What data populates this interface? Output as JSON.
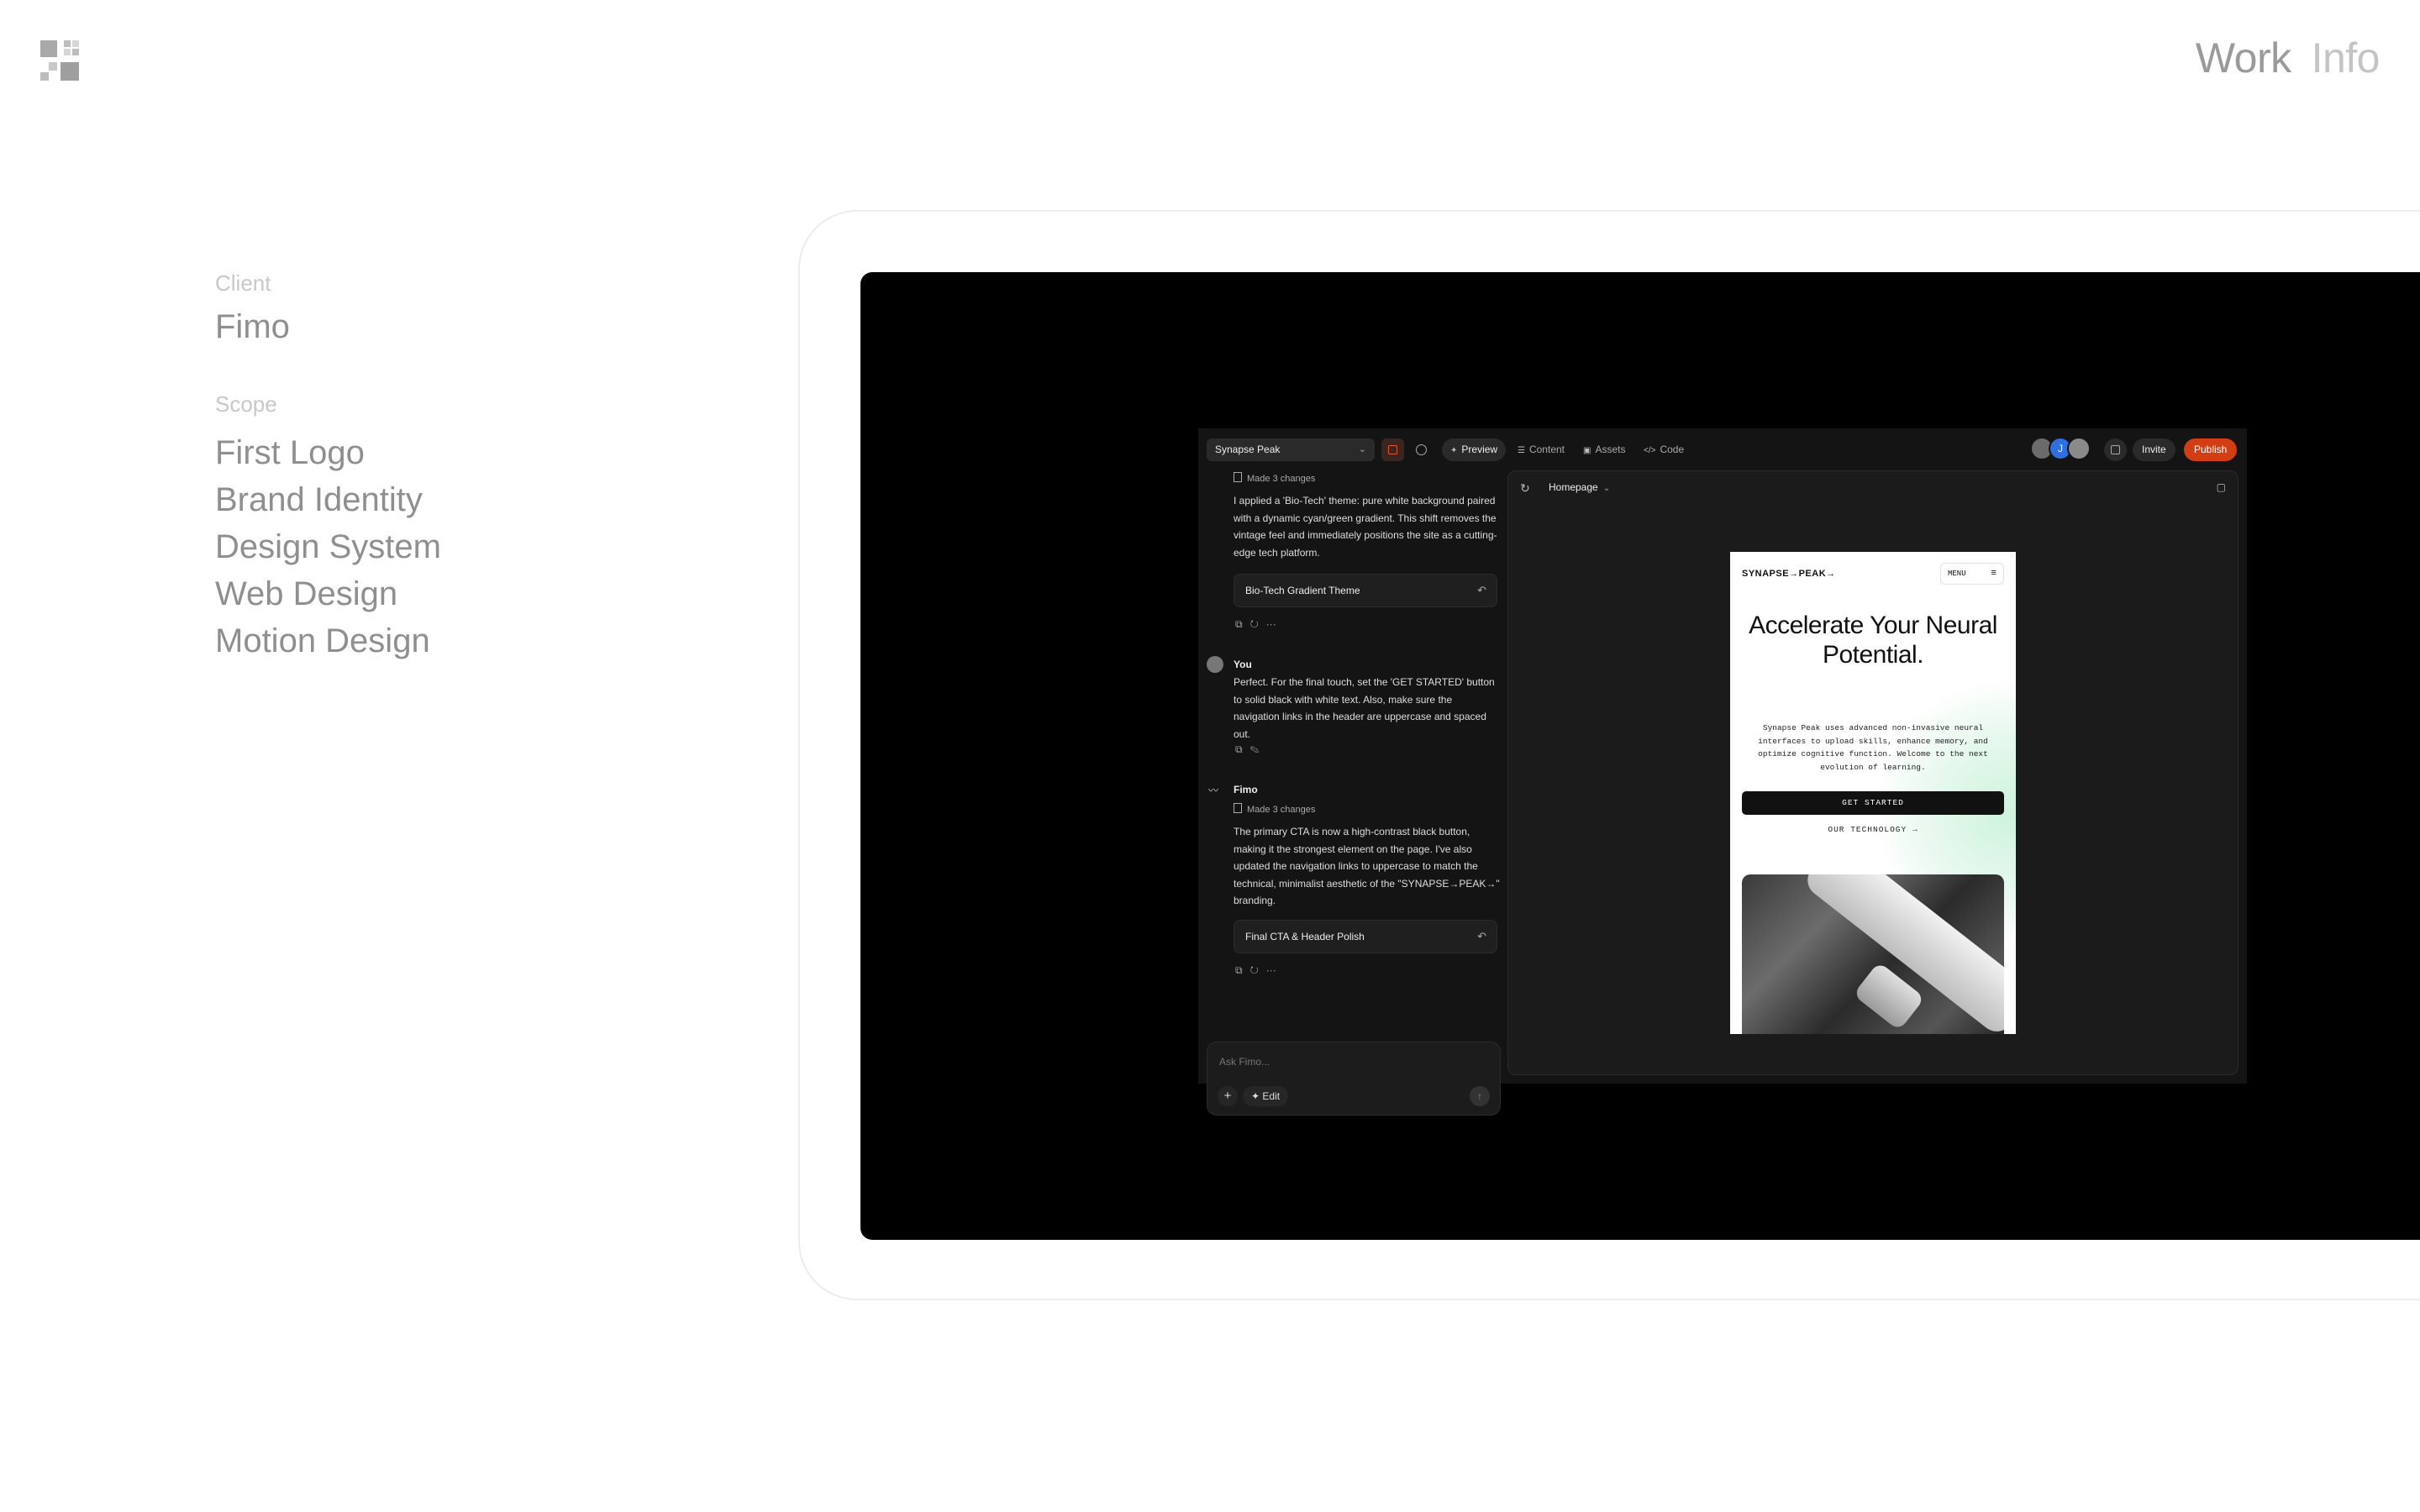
{
  "nav": {
    "work": "Work",
    "info": "Info"
  },
  "meta": {
    "client_label": "Client",
    "client": "Fimo",
    "scope_label": "Scope",
    "scope": [
      "First Logo",
      "Brand Identity",
      "Design System",
      "Web Design",
      "Motion Design"
    ]
  },
  "app": {
    "project": "Synapse Peak",
    "tabs": [
      "Preview",
      "Content",
      "Assets",
      "Code"
    ],
    "avatar_initial": "J",
    "invite": "Invite",
    "publish": "Publish",
    "accent_color": "#d23d14",
    "chat": {
      "changes_1": "Made 3 changes",
      "msg_1": "I applied a 'Bio-Tech' theme: pure white background paired with a dynamic cyan/green gradient. This shift removes the vintage feel and immediately positions the site as a cutting-edge tech platform.",
      "card_1": "Bio-Tech Gradient Theme",
      "user_name": "You",
      "user_msg": "Perfect. For the final touch, set the 'GET STARTED' button to solid black with white text. Also, make sure the navigation links in the header are uppercase and spaced out.",
      "ai_name": "Fimo",
      "changes_2": "Made 3 changes",
      "msg_2": "The primary CTA is now a high-contrast black button, making it the strongest element on the page. I've also updated the navigation links to uppercase to match the technical, minimalist aesthetic of the \"SYNAPSE→PEAK→\" branding.",
      "card_2": "Final CTA & Header Polish",
      "placeholder": "Ask Fimo...",
      "edit": "Edit"
    },
    "preview": {
      "page": "Homepage",
      "site_logo": "SYNAPSE→PEAK→",
      "menu": "MENU",
      "headline": "Accelerate Your Neural Potential.",
      "body": "Synapse Peak uses advanced non-invasive neural interfaces to upload skills, enhance memory, and optimize cognitive function. Welcome to the next evolution of learning.",
      "cta": "GET STARTED",
      "link": "OUR TECHNOLOGY →"
    }
  }
}
